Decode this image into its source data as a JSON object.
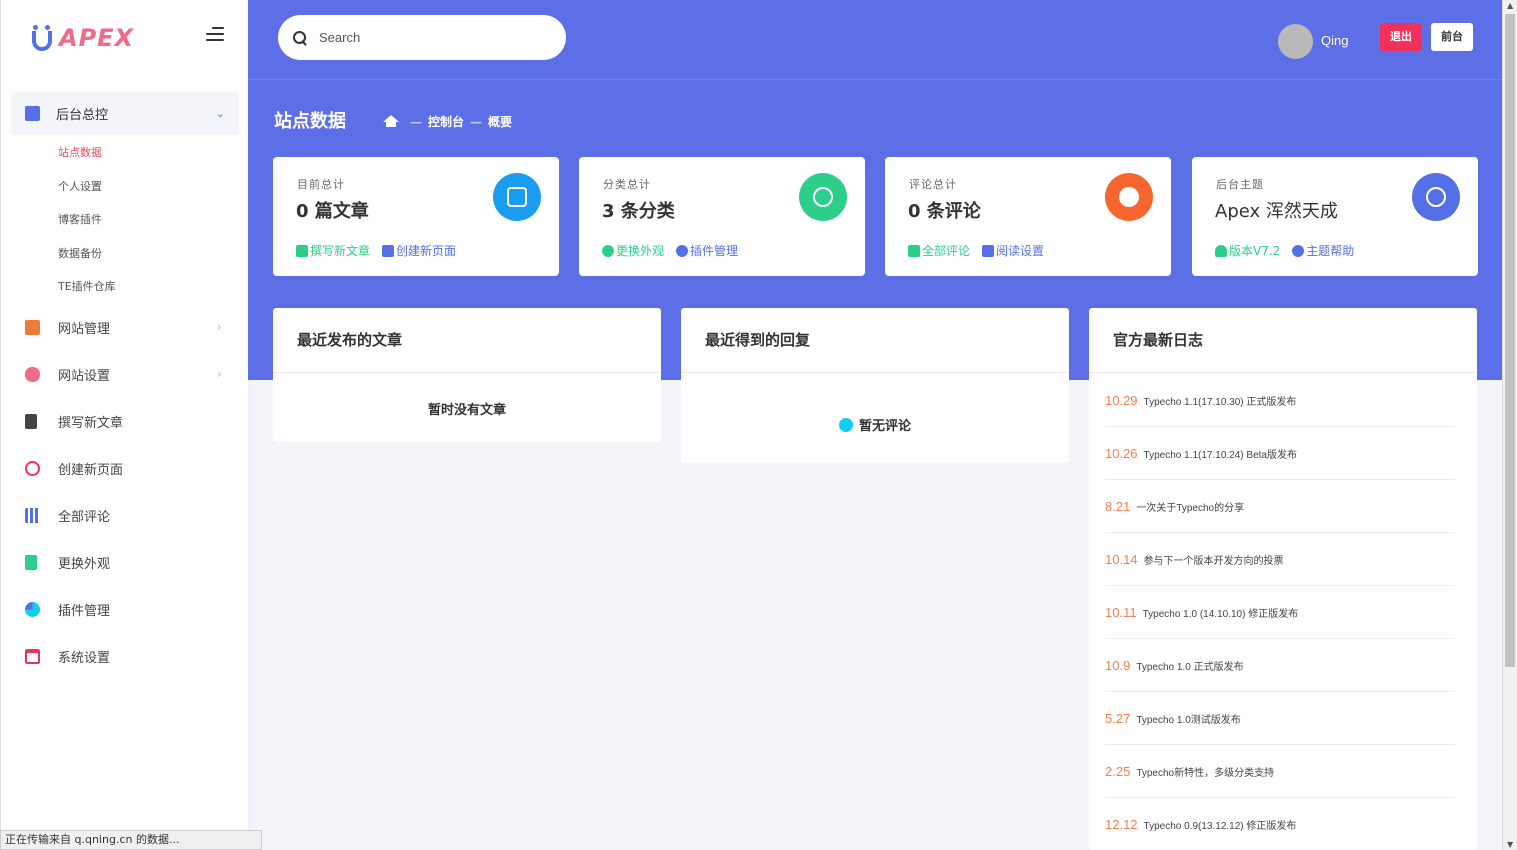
{
  "brand": {
    "logo_text": "APEX"
  },
  "search": {
    "placeholder": "Search"
  },
  "user": {
    "name": "Qing"
  },
  "buttons": {
    "logout": "退出",
    "front": "前台"
  },
  "page": {
    "title": "站点数据",
    "crumbs": [
      "控制台",
      "概要"
    ]
  },
  "sidebar": {
    "group": {
      "label": "后台总控",
      "submenu": [
        "站点数据",
        "个人设置",
        "博客插件",
        "数据备份",
        "TE插件仓库"
      ]
    },
    "items": [
      {
        "label": "网站管理",
        "icon": "briefcase-icon",
        "color": "#f07a3a",
        "has_arrow": true
      },
      {
        "label": "网站设置",
        "icon": "tools-icon",
        "color": "#f06a8a",
        "has_arrow": true
      },
      {
        "label": "撰写新文章",
        "icon": "document-icon",
        "color": "#444444",
        "has_arrow": false
      },
      {
        "label": "创建新页面",
        "icon": "atom-icon",
        "color": "#f0325a",
        "has_arrow": false
      },
      {
        "label": "全部评论",
        "icon": "books-icon",
        "color": "#5470e6",
        "has_arrow": false
      },
      {
        "label": "更换外观",
        "icon": "bag-icon",
        "color": "#2dce89",
        "has_arrow": false
      },
      {
        "label": "插件管理",
        "icon": "pie-chart-icon",
        "color": "#11cdef",
        "has_arrow": false
      },
      {
        "label": "系统设置",
        "icon": "calendar-icon",
        "color": "#f0325a",
        "has_arrow": false
      }
    ]
  },
  "cards": [
    {
      "caption": "目前总计",
      "value": "0 篇文章",
      "badge_color": "#1a9cf0",
      "icon": "contact-card-icon",
      "links": [
        "撰写新文章",
        "创建新页面"
      ]
    },
    {
      "caption": "分类总计",
      "value": "3 条分类",
      "badge_color": "#2dce89",
      "icon": "planet-icon",
      "links": [
        "更换外观",
        "插件管理"
      ]
    },
    {
      "caption": "评论总计",
      "value": "0 条评论",
      "badge_color": "#f5652d",
      "icon": "chat-bubble-icon",
      "links": [
        "全部评论",
        "阅读设置"
      ]
    },
    {
      "caption": "后台主题",
      "value": "Apex 浑然天成",
      "badge_color": "#5470e6",
      "icon": "globe-icon",
      "links": [
        "版本V7.2",
        "主题帮助"
      ]
    }
  ],
  "panels": {
    "recent_posts": {
      "title": "最近发布的文章",
      "empty": "暂时没有文章"
    },
    "recent_replies": {
      "title": "最近得到的回复",
      "empty": "暂无评论"
    },
    "official_log": {
      "title": "官方最新日志"
    }
  },
  "log_entries": [
    {
      "date": "10.29",
      "text": "Typecho 1.1(17.10.30) 正式版发布"
    },
    {
      "date": "10.26",
      "text": "Typecho 1.1(17.10.24) Beta版发布"
    },
    {
      "date": "8.21",
      "text": "一次关于Typecho的分享"
    },
    {
      "date": "10.14",
      "text": "参与下一个版本开发方向的投票"
    },
    {
      "date": "10.11",
      "text": "Typecho 1.0 (14.10.10) 修正版发布"
    },
    {
      "date": "10.9",
      "text": "Typecho 1.0 正式版发布"
    },
    {
      "date": "5.27",
      "text": "Typecho 1.0测试版发布"
    },
    {
      "date": "2.25",
      "text": "Typecho新特性，多级分类支持"
    },
    {
      "date": "12.12",
      "text": "Typecho 0.9(13.12.12) 修正版发布"
    }
  ],
  "status_bar": {
    "text": "正在传输来自 q.qning.cn 的数据..."
  },
  "colors": {
    "accent": "#5c6fe6",
    "active": "#e94b62",
    "link_green": "#2dce89",
    "date": "#f07f50"
  }
}
